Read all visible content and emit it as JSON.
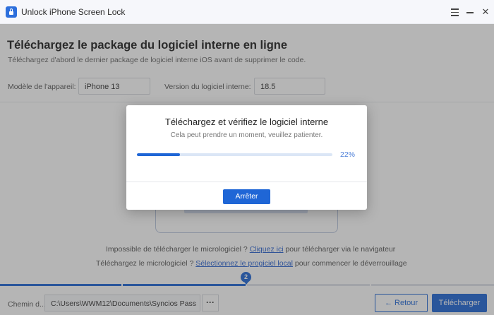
{
  "window": {
    "title": "Unlock iPhone Screen Lock"
  },
  "page": {
    "title": "Téléchargez le package du logiciel interne en ligne",
    "subtitle": "Téléchargez d'abord le dernier package de logiciel interne iOS avant de supprimer le code."
  },
  "device": {
    "model_label": "Modèle de l'appareil:",
    "model_value": "iPhone 13",
    "version_label": "Version du logiciel interne:",
    "version_value": "18.5"
  },
  "help": {
    "line1_prefix": "Impossible de télécharger le micrologiciel ? ",
    "line1_link": "Cliquez ici",
    "line1_suffix": " pour télécharger via le navigateur",
    "line2_prefix": "Téléchargez le micrologiciel ? ",
    "line2_link": "Sélectionnez le progiciel local",
    "line2_suffix": " pour commencer le déverrouillage"
  },
  "steps": {
    "current": "2",
    "fill_fraction": 0.5
  },
  "footer": {
    "save_label": "Chemin d...",
    "path_value": "C:\\Users\\WWM12\\Documents\\Syncios Pass",
    "browse_label": "···",
    "back_label": "← Retour",
    "download_label": "Télécharger"
  },
  "modal": {
    "title": "Téléchargez et vérifiez le logiciel interne",
    "subtitle": "Cela peut prendre un moment, veuillez patienter.",
    "progress_fraction": 0.22,
    "progress_text": "22%",
    "stop_label": "Arrêter"
  },
  "colors": {
    "accent": "#1f66d6",
    "link": "#2a63d1"
  }
}
